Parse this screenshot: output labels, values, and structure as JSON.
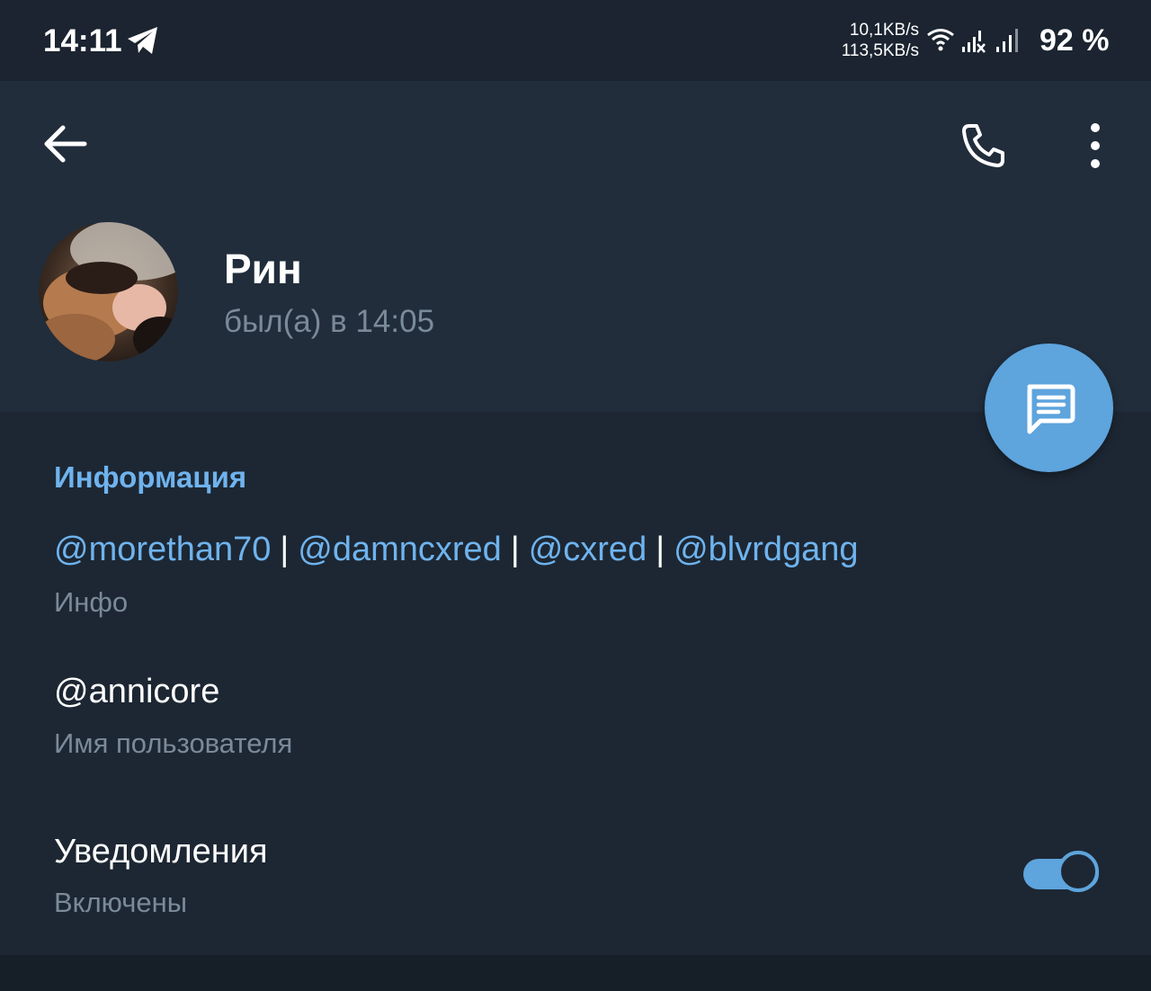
{
  "status_bar": {
    "time": "14:11",
    "net_up": "10,1KB/s",
    "net_down": "113,5KB/s",
    "battery": "92 %",
    "icons": [
      "telegram-icon",
      "wifi-icon",
      "signal-icon",
      "signal-icon"
    ]
  },
  "toolbar": {
    "icons": [
      "back-arrow-icon",
      "phone-icon",
      "more-vertical-icon"
    ]
  },
  "profile": {
    "name": "Рин",
    "last_seen": "был(а) в 14:05"
  },
  "info": {
    "section_title": "Информация",
    "bio_links": [
      "@morethan70",
      "@damncxred",
      "@cxred",
      "@blvrdgang"
    ],
    "bio_separator": "|",
    "bio_caption": "Инфо",
    "username": "@annicore",
    "username_caption": "Имя пользователя",
    "notifications_title": "Уведомления",
    "notifications_state": "Включены",
    "notifications_enabled": true
  },
  "colors": {
    "background": "#1d2733",
    "header": "#212d3b",
    "accent": "#5ea4dd",
    "link": "#6fb3ee",
    "secondary_text": "#7b8a99"
  },
  "fab": {
    "icon": "message-icon"
  }
}
